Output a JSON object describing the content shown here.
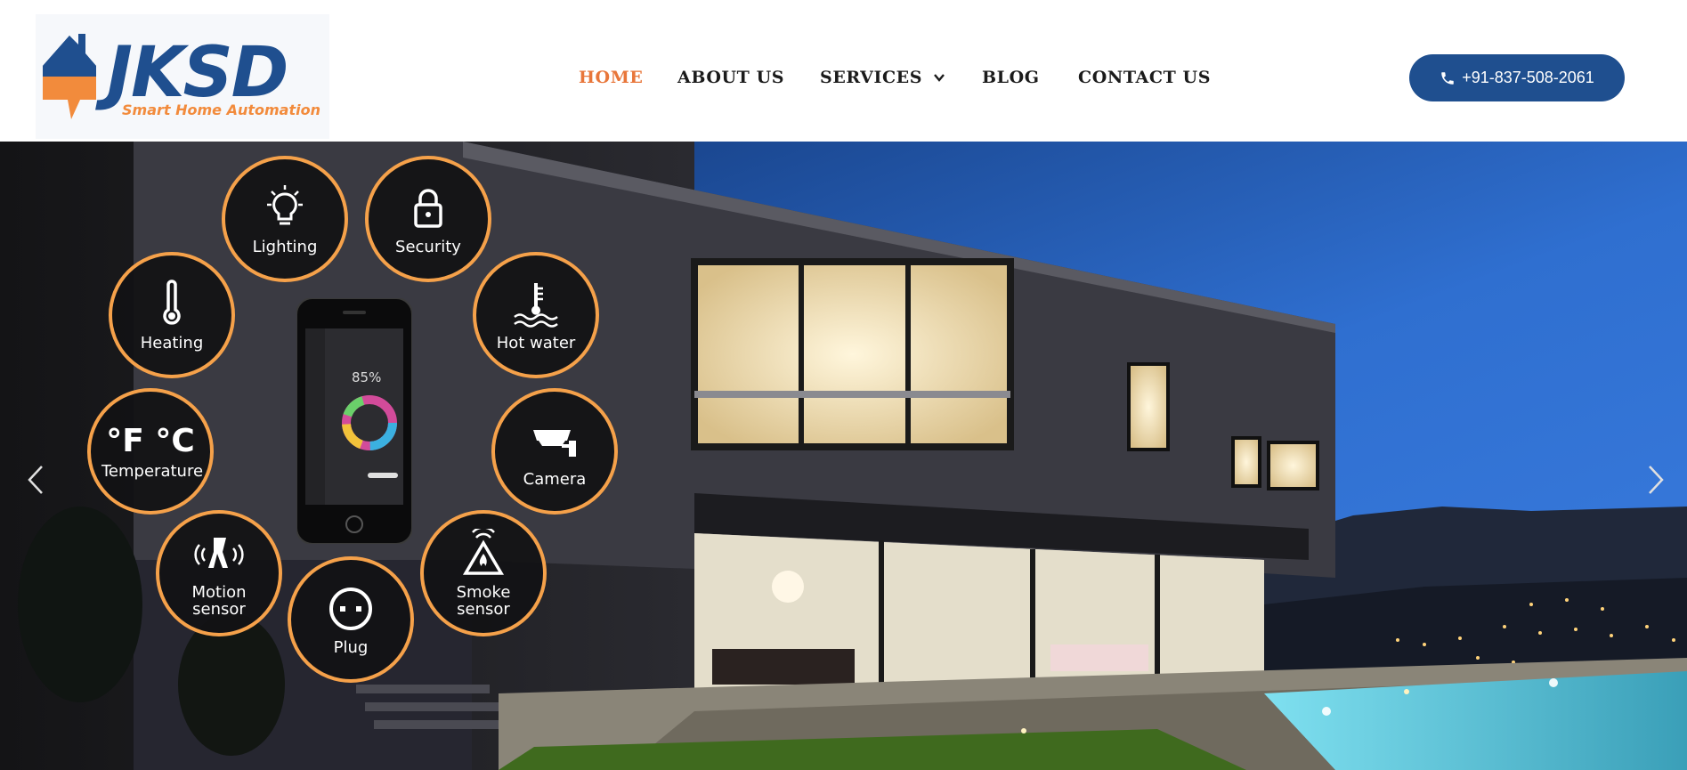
{
  "brand": {
    "name": "JKSD",
    "tagline": "Smart Home Automation",
    "colors": {
      "primary": "#1f4f8f",
      "accent": "#f28b3c"
    }
  },
  "nav": {
    "items": [
      {
        "label": "HOME",
        "active": true
      },
      {
        "label": "ABOUT US"
      },
      {
        "label": "SERVICES",
        "has_dropdown": true
      },
      {
        "label": "BLOG"
      },
      {
        "label": "CONTACT US"
      }
    ],
    "active_color": "#e8763a"
  },
  "contact": {
    "phone": "+91-837-508-2061",
    "icon": "phone-icon"
  },
  "hero": {
    "features": [
      {
        "label": "Lighting",
        "icon": "lightbulb-icon"
      },
      {
        "label": "Security",
        "icon": "lock-icon"
      },
      {
        "label": "Heating",
        "icon": "thermometer-icon"
      },
      {
        "label": "Hot water",
        "icon": "water-heater-icon"
      },
      {
        "label": "Temperature",
        "icon": "celsius-icon",
        "glyph": "°F °C"
      },
      {
        "label": "Camera",
        "icon": "camera-icon"
      },
      {
        "label": "Motion sensor",
        "icon": "motion-sensor-icon"
      },
      {
        "label": "Plug",
        "icon": "plug-icon"
      },
      {
        "label": "Smoke sensor",
        "icon": "smoke-sensor-icon"
      }
    ],
    "phone_display": {
      "percent": "85%"
    },
    "ring_color": "#f5a14a"
  },
  "slider": {
    "prev_icon": "chevron-left-icon",
    "next_icon": "chevron-right-icon"
  }
}
